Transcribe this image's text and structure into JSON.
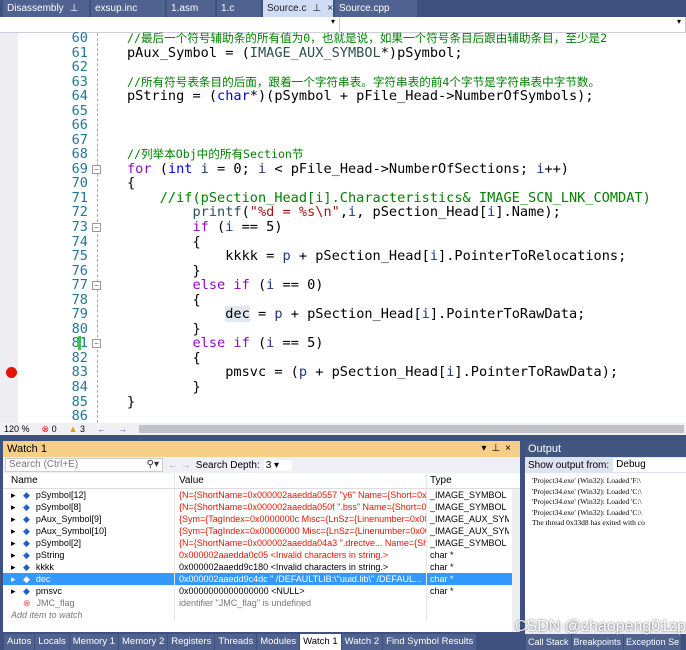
{
  "tabs": [
    {
      "label": "Disassembly",
      "pin": "⊥"
    },
    {
      "label": "exsup.inc"
    },
    {
      "label": "1.asm"
    },
    {
      "label": "1.c"
    },
    {
      "label": "Source.c",
      "pin": "⊥",
      "close": "×",
      "active": true
    },
    {
      "label": "Source.cpp"
    }
  ],
  "editor": {
    "line_numbers": [
      "60",
      "61",
      "62",
      "63",
      "64",
      "65",
      "66",
      "67",
      "68",
      "69",
      "70",
      "71",
      "72",
      "73",
      "74",
      "75",
      "76",
      "77",
      "78",
      "79",
      "80",
      "81",
      "82",
      "83",
      "84",
      "85",
      "86"
    ],
    "lines": [
      [
        [
          "cm",
          "//最后一个符号辅助条的所有值为0，也就是说，如果一个符号条目后跟由辅助条目，至少是2"
        ]
      ],
      [
        [
          "",
          "pAux_Symbol = ("
        ],
        [
          "m",
          "IMAGE_AUX_SYMBOL"
        ],
        [
          "",
          "*)pSymbol;"
        ]
      ],
      [],
      [
        [
          "cm",
          "//所有符号表条目的后面，跟着一个字符串表。字符串表的前4个字节是字符串表中字节数。"
        ]
      ],
      [
        [
          "",
          "pString = ("
        ],
        [
          "k",
          "char"
        ],
        [
          "",
          "*)(pSymbol + pFile_Head->NumberOfSymbols);"
        ]
      ],
      [],
      [],
      [],
      [
        [
          "cm",
          "//列举本Obj中的所有Section节"
        ]
      ],
      [
        [
          "cf",
          "for"
        ],
        [
          "",
          " ("
        ],
        [
          "k",
          "int"
        ],
        [
          "v",
          " i"
        ],
        [
          "",
          " = 0; "
        ],
        [
          "v",
          "i"
        ],
        [
          "",
          " < pFile_Head->NumberOfSections; "
        ],
        [
          "v",
          "i"
        ],
        [
          "",
          "++)"
        ]
      ],
      [
        [
          "",
          "{"
        ]
      ],
      [
        [
          "cm",
          "    //if(pSection_Head[i].Characteristics& IMAGE_SCN_LNK_COMDAT)"
        ]
      ],
      [
        [
          "",
          "        "
        ],
        [
          "m",
          "printf"
        ],
        [
          "",
          "("
        ],
        [
          "s",
          "\"%d = %s\\n\""
        ],
        [
          "",
          ","
        ],
        [
          "v",
          "i"
        ],
        [
          "",
          ", pSection_Head["
        ],
        [
          "v",
          "i"
        ],
        [
          "",
          "].Name);"
        ]
      ],
      [
        [
          "",
          "        "
        ],
        [
          "cf",
          "if"
        ],
        [
          "",
          " ("
        ],
        [
          "v",
          "i"
        ],
        [
          "",
          " == 5)"
        ]
      ],
      [
        [
          "",
          "        {"
        ]
      ],
      [
        [
          "",
          "            kkkk = "
        ],
        [
          "v",
          "p"
        ],
        [
          "",
          " + pSection_Head["
        ],
        [
          "v",
          "i"
        ],
        [
          "",
          "].PointerToRelocations;"
        ]
      ],
      [
        [
          "",
          "        }"
        ]
      ],
      [
        [
          "",
          "        "
        ],
        [
          "cf",
          "else if"
        ],
        [
          "",
          " ("
        ],
        [
          "v",
          "i"
        ],
        [
          "",
          " == 0)"
        ]
      ],
      [
        [
          "",
          "        {"
        ]
      ],
      [
        [
          "",
          "            "
        ],
        [
          "hl",
          "dec"
        ],
        [
          "",
          " = "
        ],
        [
          "v",
          "p"
        ],
        [
          "",
          " + pSection_Head["
        ],
        [
          "v",
          "i"
        ],
        [
          "",
          "].PointerToRawData;"
        ]
      ],
      [
        [
          "",
          "        }"
        ]
      ],
      [
        [
          "",
          "        "
        ],
        [
          "cf",
          "else if"
        ],
        [
          "",
          " ("
        ],
        [
          "v",
          "i"
        ],
        [
          "",
          " == 5)"
        ]
      ],
      [
        [
          "",
          "        {"
        ]
      ],
      [
        [
          "",
          "            pmsvc = ("
        ],
        [
          "v",
          "p"
        ],
        [
          "",
          " + pSection_Head["
        ],
        [
          "v",
          "i"
        ],
        [
          "",
          "].PointerToRawData);"
        ]
      ],
      [
        [
          "",
          "        }"
        ]
      ],
      [
        [
          "",
          "}"
        ]
      ],
      []
    ],
    "breakpoint_line": "83",
    "changed_line": "81"
  },
  "status": {
    "zoom": "120 %",
    "errors": "0",
    "warnings": "3"
  },
  "watch": {
    "title": "Watch 1",
    "search_placeholder": "Search (Ctrl+E)",
    "search_depth_label": "Search Depth:",
    "search_depth": "3",
    "columns": [
      "Name",
      "Value",
      "Type"
    ],
    "rows": [
      {
        "name": "pSymbol[12]",
        "value": "{N={ShortName=0x000002aaedda0557 \"y6\" Name={Short=0x00...",
        "type": "_IMAGE_SYMBOL",
        "changed": true,
        "icon": "field"
      },
      {
        "name": "pSymbol[8]",
        "value": "{N={ShortName=0x000002aaedda050f \".bss\" Name={Short=0x7...",
        "type": "_IMAGE_SYMBOL",
        "changed": true,
        "icon": "field"
      },
      {
        "name": "pAux_Symbol[9]",
        "value": "{Sym={TagIndex=0x0000000c Misc={LnSz={Linenumber=0x000...",
        "type": "_IMAGE_AUX_SYM...",
        "changed": true,
        "icon": "field"
      },
      {
        "name": "pAux_Symbol[10]",
        "value": "{Sym={TagIndex=0x00000000 Misc={LnSz={Linenumber=0x000...",
        "type": "_IMAGE_AUX_SYM...",
        "changed": true,
        "icon": "field"
      },
      {
        "name": "pSymbol[2]",
        "value": "{N={ShortName=0x000002aaedda04a3 \".drectve... Name={Shor...",
        "type": "_IMAGE_SYMBOL",
        "changed": true,
        "icon": "field"
      },
      {
        "name": "pString",
        "value": "0x000002aaedda0c05  <Invalid characters in string.>",
        "type": "char *",
        "changed": true,
        "icon": "local"
      },
      {
        "name": "kkkk",
        "value": "0x000002aaedd9c180  <Invalid characters in string.>",
        "type": "char *",
        "icon": "field",
        "viewer": true
      },
      {
        "name": "dec",
        "value": "0x000002aaedd9c4dc \"   /DEFAULTLIB:\\\"uuid.lib\\\" /DEFAUL...",
        "type": "char *",
        "icon": "field",
        "viewer": true,
        "selected": true
      },
      {
        "name": "pmsvc",
        "value": "0x0000000000000000 <NULL>",
        "type": "char *",
        "icon": "local"
      },
      {
        "name": "JMC_flag",
        "value": "identifier \"JMC_flag\" is undefined",
        "type": "",
        "icon": "error",
        "refresh": true
      }
    ],
    "add_item_placeholder": "Add item to watch"
  },
  "output": {
    "title": "Output",
    "show_from_label": "Show output from:",
    "source": "Debug",
    "lines": [
      "'Project34.exe' (Win32): Loaded 'F:\\",
      "'Project34.exe' (Win32): Loaded 'C:\\",
      "'Project34.exe' (Win32): Loaded 'C:\\",
      "'Project34.exe' (Win32): Loaded 'C:\\",
      "The thread 0x33d8 has exited with co"
    ]
  },
  "bottom_tabs": [
    {
      "label": "Autos"
    },
    {
      "label": "Locals"
    },
    {
      "label": "Memory 1"
    },
    {
      "label": "Memory 2"
    },
    {
      "label": "Registers"
    },
    {
      "label": "Threads"
    },
    {
      "label": "Modules"
    },
    {
      "label": "Watch 1",
      "active": true
    },
    {
      "label": "Watch 2"
    },
    {
      "label": "Find Symbol Results"
    },
    {
      "label": "Call Stack",
      "gap": true
    },
    {
      "label": "Breakpoints"
    },
    {
      "label": "Exception Se"
    }
  ],
  "watermark": "CSDN @zhaopeng01zp",
  "colors": {
    "accent": "#3399ff",
    "watch_title": "#f6cf87",
    "error_value": "#e51400",
    "breakpoint": "#e51400"
  }
}
